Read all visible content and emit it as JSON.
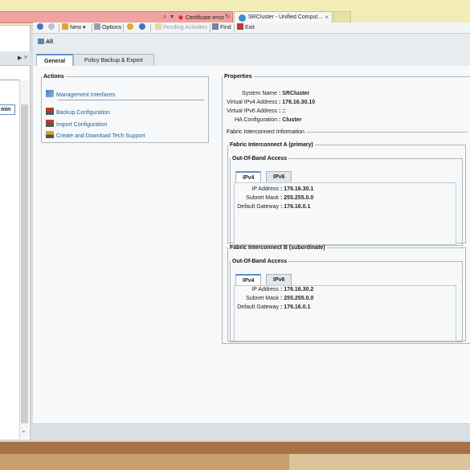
{
  "browser": {
    "cert_error": "Certificate error",
    "tab_title": "SRCluster - Unified Comput...",
    "tab_close": "×"
  },
  "left_panel": {
    "tab_label": "min",
    "nav_right": "▶",
    "nav_double": "»"
  },
  "toolbar": {
    "new": "New ▾",
    "options": "Options",
    "pending": "Pending Activities",
    "find": "Find",
    "exit": "Exit"
  },
  "breadcrumb": {
    "label": "All"
  },
  "tabs": [
    "General",
    "Policy Backup & Export"
  ],
  "actions": {
    "title": "Actions",
    "items": [
      "Management Interfaces",
      "Backup Configuration",
      "Import Configuration",
      "Create and Download Tech Support"
    ]
  },
  "properties": {
    "title": "Properties",
    "rows": [
      {
        "label": "System Name",
        "value": "SRCluster"
      },
      {
        "label": "Virtual IPv4 Address",
        "value": "176.16.30.10"
      },
      {
        "label": "Virtual IPv6 Address",
        "value": "::"
      },
      {
        "label": "HA Configuration",
        "value": "Cluster"
      }
    ],
    "fi_info_title": "Fabric Interconnect Information",
    "fi_a": {
      "title": "Fabric Interconnect A (primary)",
      "oob_title": "Out-Of-Band Access",
      "tabs": [
        "IPv4",
        "IPv6"
      ],
      "rows": [
        {
          "label": "IP Address",
          "value": "176.16.30.1"
        },
        {
          "label": "Subnet Mask",
          "value": "255.255.0.0"
        },
        {
          "label": "Default Gateway",
          "value": "176.16.0.1"
        }
      ]
    },
    "fi_b": {
      "title": "Fabric Interconnect B (subordinate)",
      "oob_title": "Out-Of-Band Access",
      "tabs": [
        "IPv4",
        "IPv6"
      ],
      "rows": [
        {
          "label": "IP Address",
          "value": "176.16.30.2"
        },
        {
          "label": "Subnet Mask",
          "value": "255.255.0.0"
        },
        {
          "label": "Default Gateway",
          "value": "176.16.0.1"
        }
      ]
    }
  },
  "colors": {
    "link": "#1f5fa8",
    "tab_accent": "#5a8fd0",
    "cert_bar": "#f0a3a0"
  }
}
